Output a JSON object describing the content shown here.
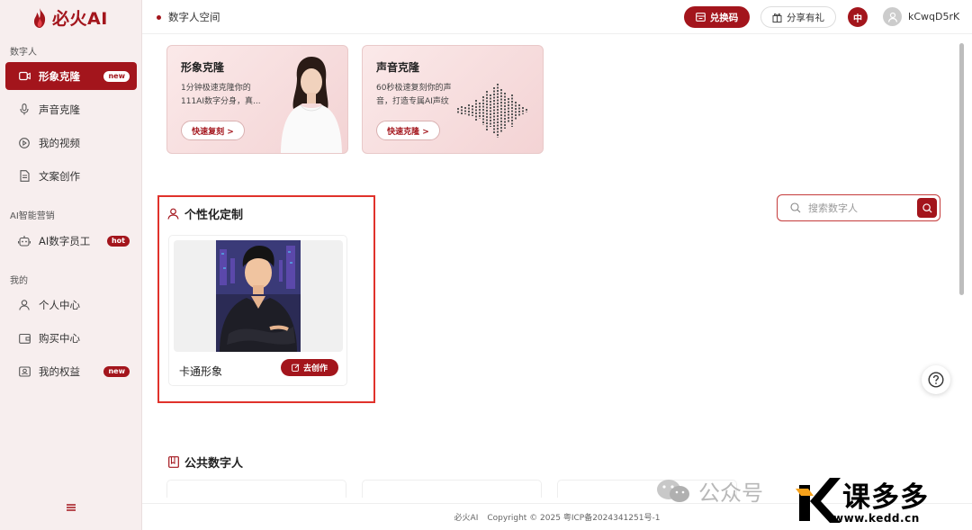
{
  "app": {
    "logo_text": "必火AI"
  },
  "sidebar": {
    "sections": [
      {
        "title": "数字人"
      },
      {
        "title": "AI智能营销"
      },
      {
        "title": "我的"
      }
    ],
    "items": [
      {
        "label": "形象克隆",
        "badge": "new",
        "active": true,
        "icon": "video-icon"
      },
      {
        "label": "声音克隆",
        "badge": "",
        "icon": "microphone-icon"
      },
      {
        "label": "我的视频",
        "badge": "",
        "icon": "play-circle-icon"
      },
      {
        "label": "文案创作",
        "badge": "",
        "icon": "document-icon"
      },
      {
        "label": "AI数字员工",
        "badge": "hot",
        "icon": "robot-icon"
      },
      {
        "label": "个人中心",
        "badge": "",
        "icon": "user-icon"
      },
      {
        "label": "购买中心",
        "badge": "",
        "icon": "wallet-icon"
      },
      {
        "label": "我的权益",
        "badge": "new",
        "icon": "benefits-icon"
      }
    ]
  },
  "header": {
    "breadcrumb": "数字人空间",
    "redeem_label": "兑换码",
    "share_label": "分享有礼",
    "lang_label": "中",
    "username": "kCwqD5rK"
  },
  "clone_cards": [
    {
      "title": "形象克隆",
      "desc": "1分钟极速克隆你的111AI数字分身，真...",
      "button": "快速复刻 >"
    },
    {
      "title": "声音克隆",
      "desc": "60秒极速复刻你的声音，打造专属AI声纹",
      "button": "快速克隆 >"
    }
  ],
  "custom": {
    "title": "个性化定制",
    "avatar_name": "卡通形象",
    "create_label": "去创作"
  },
  "search": {
    "placeholder": "搜索数字人"
  },
  "public": {
    "title": "公共数字人"
  },
  "footer": {
    "brand": "必火AI",
    "copyright": "Copyright © 2025 粤ICP备2024341251号-1"
  },
  "watermark": {
    "wechat_text": "公众号",
    "brand_name": "课多多",
    "url": "www.kedd.cn"
  },
  "colors": {
    "accent": "#a3151c",
    "highlight_border": "#e0322b",
    "sidebar_bg": "#f7eeee"
  }
}
